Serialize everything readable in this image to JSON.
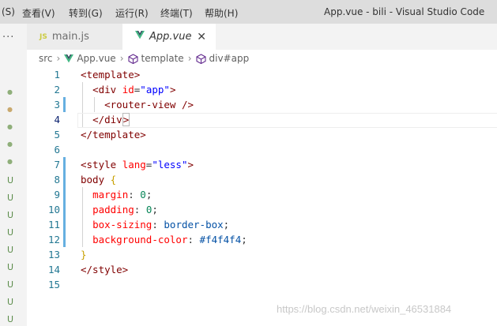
{
  "menubar": {
    "items": [
      "(S)",
      "查看(V)",
      "转到(G)",
      "运行(R)",
      "终端(T)",
      "帮助(H)"
    ],
    "window_title": "App.vue - bili - Visual Studio Code"
  },
  "activity": {
    "more": "···",
    "markers": [
      "●",
      "●",
      "●",
      "●",
      "●",
      "U",
      "U",
      "U",
      "U",
      "U",
      "U",
      "U",
      "U",
      "U"
    ]
  },
  "tabs": [
    {
      "icon": "JS",
      "label": "main.js"
    },
    {
      "icon": "vue-icon",
      "label": "App.vue",
      "close": "✕"
    }
  ],
  "breadcrumb": [
    "src",
    "App.vue",
    "template",
    "div#app"
  ],
  "editor": {
    "line_numbers": [
      "1",
      "2",
      "3",
      "4",
      "5",
      "6",
      "7",
      "8",
      "9",
      "10",
      "11",
      "12",
      "13",
      "14",
      "15"
    ],
    "lines": {
      "l1": {
        "a": "<template>"
      },
      "l2": {
        "a": "<div",
        "b": "id",
        "c": "=",
        "d": "\"app\"",
        "e": ">"
      },
      "l3": {
        "a": "<router-view />"
      },
      "l4": {
        "a": "</div",
        "b": ">"
      },
      "l5": {
        "a": "</template>"
      },
      "l7": {
        "a": "<style",
        "b": "lang",
        "c": "=",
        "d": "\"less\"",
        "e": ">"
      },
      "l8": {
        "a": "body",
        "b": "{"
      },
      "l9": {
        "a": "margin",
        "b": ": ",
        "c": "0",
        "d": ";"
      },
      "l10": {
        "a": "padding",
        "b": ": ",
        "c": "0",
        "d": ";"
      },
      "l11": {
        "a": "box-sizing",
        "b": ": ",
        "c": "border-box",
        "d": ";"
      },
      "l12": {
        "a": "background-color",
        "b": ": ",
        "c": "#f4f4f4",
        "d": ";"
      },
      "l13": {
        "a": "}"
      },
      "l14": {
        "a": "</style>"
      }
    }
  },
  "watermark": "https://blog.csdn.net/weixin_46531884",
  "colors": {
    "accent_line": "#66afe0",
    "line_number": "#237893",
    "vue_green": "#41b883"
  }
}
